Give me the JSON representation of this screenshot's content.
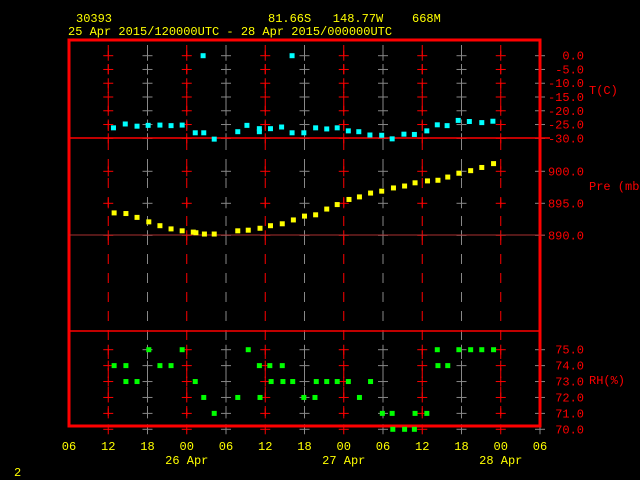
{
  "header": {
    "station": "30393",
    "location": "81.66S   148.77W    668M",
    "period": "25 Apr 2015/120000UTC - 28 Apr 2015/000000UTC"
  },
  "footer": {
    "page_number": "2"
  },
  "colors": {
    "temperature": "#00ffff",
    "pressure": "#ffff00",
    "humidity": "#00ff00",
    "frame": "#ff0000",
    "text": "#ffff00",
    "axis_text": "#ff0000"
  },
  "chart_data": [
    {
      "type": "scatter",
      "title": "T(C)",
      "ylabel": "T(C)",
      "ylim": [
        -30,
        0
      ],
      "yticks": [
        "0.0",
        "-5.0",
        "-10.0",
        "-15.0",
        "-20.0",
        "-25.0",
        "-30.0"
      ],
      "ytick_values": [
        0,
        -5,
        -10,
        -15,
        -20,
        -25,
        -30
      ],
      "x_units": "hours since 25 Apr 06UTC",
      "points": [
        [
          6.8,
          -26.2
        ],
        [
          8.6,
          -24.8
        ],
        [
          10.4,
          -25.6
        ],
        [
          12.1,
          -25.3
        ],
        [
          13.9,
          -25.2
        ],
        [
          15.6,
          -25.4
        ],
        [
          17.3,
          -25.2
        ],
        [
          19.3,
          -28.0
        ],
        [
          20.5,
          0.0
        ],
        [
          20.6,
          -28.0
        ],
        [
          22.2,
          -30.3
        ],
        [
          25.8,
          -27.6
        ],
        [
          27.2,
          -25.3
        ],
        [
          29.1,
          -26.5
        ],
        [
          29.1,
          -27.6
        ],
        [
          30.8,
          -26.5
        ],
        [
          32.5,
          -25.9
        ],
        [
          34.1,
          0.0
        ],
        [
          34.1,
          -28.0
        ],
        [
          35.9,
          -28.0
        ],
        [
          37.7,
          -26.2
        ],
        [
          39.4,
          -26.6
        ],
        [
          41.0,
          -26.2
        ],
        [
          42.7,
          -27.3
        ],
        [
          44.3,
          -27.6
        ],
        [
          46.0,
          -28.8
        ],
        [
          47.8,
          -28.9
        ],
        [
          49.4,
          -30.2
        ],
        [
          51.2,
          -28.5
        ],
        [
          52.8,
          -28.6
        ],
        [
          54.7,
          -27.3
        ],
        [
          56.3,
          -25.1
        ],
        [
          57.8,
          -25.4
        ],
        [
          59.5,
          -23.5
        ],
        [
          61.2,
          -23.9
        ],
        [
          63.1,
          -24.3
        ],
        [
          64.8,
          -23.8
        ]
      ]
    },
    {
      "type": "scatter",
      "title": "Pre (mb)",
      "ylabel": "Pre (mb)",
      "ylim": [
        890,
        900
      ],
      "yticks": [
        "900.0",
        "895.0",
        "890.0"
      ],
      "ytick_values": [
        900,
        895,
        890
      ],
      "x_units": "hours since 25 Apr 06UTC",
      "points": [
        [
          6.9,
          893.5
        ],
        [
          8.7,
          893.4
        ],
        [
          10.4,
          892.8
        ],
        [
          12.2,
          892.1
        ],
        [
          13.9,
          891.5
        ],
        [
          15.6,
          891.0
        ],
        [
          17.3,
          890.7
        ],
        [
          19.0,
          890.5
        ],
        [
          19.4,
          890.4
        ],
        [
          20.7,
          890.2
        ],
        [
          22.2,
          890.2
        ],
        [
          25.8,
          890.7
        ],
        [
          27.4,
          890.8
        ],
        [
          29.2,
          891.1
        ],
        [
          30.8,
          891.5
        ],
        [
          32.6,
          891.8
        ],
        [
          34.3,
          892.4
        ],
        [
          36.0,
          893.0
        ],
        [
          37.7,
          893.2
        ],
        [
          39.4,
          894.1
        ],
        [
          41.0,
          894.8
        ],
        [
          42.8,
          895.6
        ],
        [
          44.4,
          896.0
        ],
        [
          46.1,
          896.6
        ],
        [
          47.8,
          896.9
        ],
        [
          49.6,
          897.4
        ],
        [
          51.3,
          897.7
        ],
        [
          52.9,
          898.2
        ],
        [
          54.8,
          898.5
        ],
        [
          56.4,
          898.6
        ],
        [
          57.9,
          899.1
        ],
        [
          59.6,
          899.7
        ],
        [
          61.4,
          900.1
        ],
        [
          63.1,
          900.6
        ],
        [
          64.9,
          901.2
        ]
      ]
    },
    {
      "type": "scatter",
      "title": "RH(%)",
      "ylabel": "RH(%)",
      "ylim": [
        70,
        75
      ],
      "yticks": [
        "75.0",
        "74.0",
        "73.0",
        "72.0",
        "71.0",
        "70.0"
      ],
      "ytick_values": [
        75,
        74,
        73,
        72,
        71,
        70
      ],
      "x_units": "hours since 25 Apr 06UTC",
      "points": [
        [
          6.9,
          74
        ],
        [
          8.7,
          74
        ],
        [
          8.7,
          73
        ],
        [
          10.4,
          73
        ],
        [
          12.2,
          75
        ],
        [
          13.9,
          74
        ],
        [
          15.6,
          74
        ],
        [
          17.3,
          75
        ],
        [
          19.3,
          73
        ],
        [
          20.6,
          72
        ],
        [
          22.2,
          71
        ],
        [
          25.8,
          72
        ],
        [
          27.4,
          75
        ],
        [
          29.1,
          74
        ],
        [
          29.2,
          72
        ],
        [
          30.7,
          74
        ],
        [
          30.9,
          73
        ],
        [
          32.6,
          74
        ],
        [
          32.7,
          73
        ],
        [
          34.2,
          73
        ],
        [
          35.9,
          72
        ],
        [
          37.6,
          72
        ],
        [
          37.8,
          73
        ],
        [
          39.4,
          73
        ],
        [
          41.0,
          73
        ],
        [
          42.7,
          73
        ],
        [
          44.4,
          72
        ],
        [
          46.1,
          73
        ],
        [
          47.9,
          71
        ],
        [
          49.4,
          71
        ],
        [
          49.5,
          70
        ],
        [
          51.3,
          70
        ],
        [
          52.8,
          70
        ],
        [
          52.9,
          71
        ],
        [
          54.7,
          71
        ],
        [
          56.3,
          75
        ],
        [
          56.4,
          74
        ],
        [
          57.9,
          74
        ],
        [
          59.6,
          75
        ],
        [
          61.4,
          75
        ],
        [
          63.1,
          75
        ],
        [
          64.9,
          75
        ]
      ]
    }
  ],
  "x_axis": {
    "xlim_hours": [
      0,
      72
    ],
    "tick_labels": [
      "06",
      "12",
      "18",
      "00",
      "06",
      "12",
      "18",
      "00",
      "06",
      "12",
      "18",
      "00",
      "06"
    ],
    "day_labels": [
      "26 Apr",
      "27 Apr",
      "28 Apr"
    ],
    "day_label_hours": [
      18,
      42,
      66
    ]
  }
}
